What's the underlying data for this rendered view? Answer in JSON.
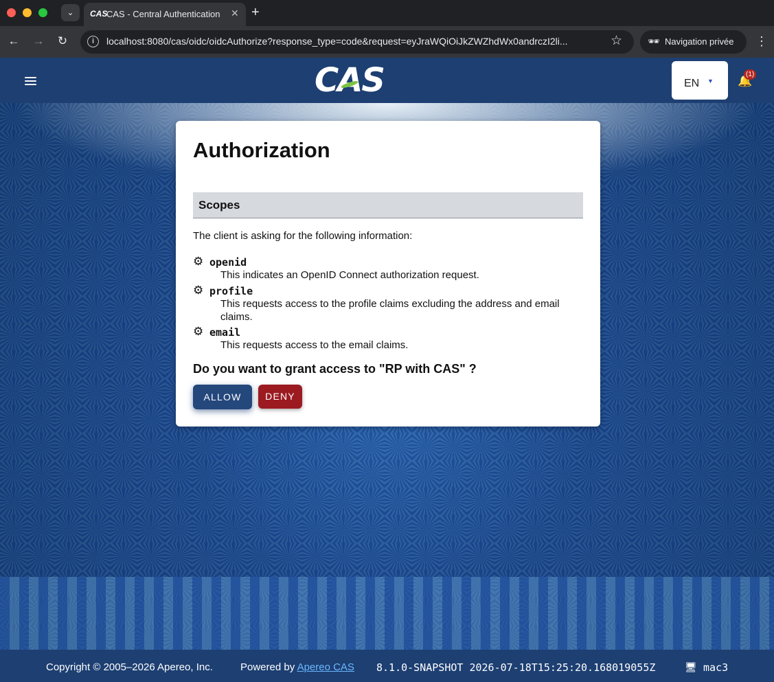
{
  "browser": {
    "tab_title": "CAS - Central Authentication Service",
    "tab_favicon": "CAS",
    "url": "localhost:8080/cas/oidc/oidcAuthorize?response_type=code&request=eyJraWQiOiJkZWZhdWx0andrczI2li...",
    "private_label": "Navigation privée",
    "icons": {
      "tab_menu": "chevron-down-icon",
      "close": "close-icon",
      "new_tab": "plus-icon",
      "back": "arrow-left-icon",
      "forward": "arrow-right-icon",
      "reload": "reload-icon",
      "info": "info-icon",
      "bookmark": "star-icon",
      "incognito": "incognito-icon",
      "menu": "kebab-menu-icon"
    }
  },
  "header": {
    "logo_text": "CAS",
    "language": "EN",
    "notification_badge": "(1)",
    "colors": {
      "bar": "#1d3f72",
      "logo_swoosh": "#7cc242"
    }
  },
  "card": {
    "title": "Authorization",
    "section_title": "Scopes",
    "intro": "The client is asking for the following information:",
    "scopes": [
      {
        "name": "openid",
        "description": "This indicates an OpenID Connect authorization request."
      },
      {
        "name": "profile",
        "description": "This requests access to the profile claims excluding the address and email claims."
      },
      {
        "name": "email",
        "description": "This requests access to the email claims."
      }
    ],
    "question": "Do you want to grant access to \"RP with CAS\" ?",
    "allow_label": "ALLOW",
    "deny_label": "DENY",
    "colors": {
      "allow": "#24477c",
      "deny": "#9b1b21"
    }
  },
  "footer": {
    "copyright": "Copyright © 2005–2026 Apereo, Inc.",
    "powered_by": "Powered by",
    "powered_link": "Apereo CAS",
    "version": "8.1.0-SNAPSHOT 2026-07-18T15:25:20.168019055Z",
    "host": "mac3"
  }
}
